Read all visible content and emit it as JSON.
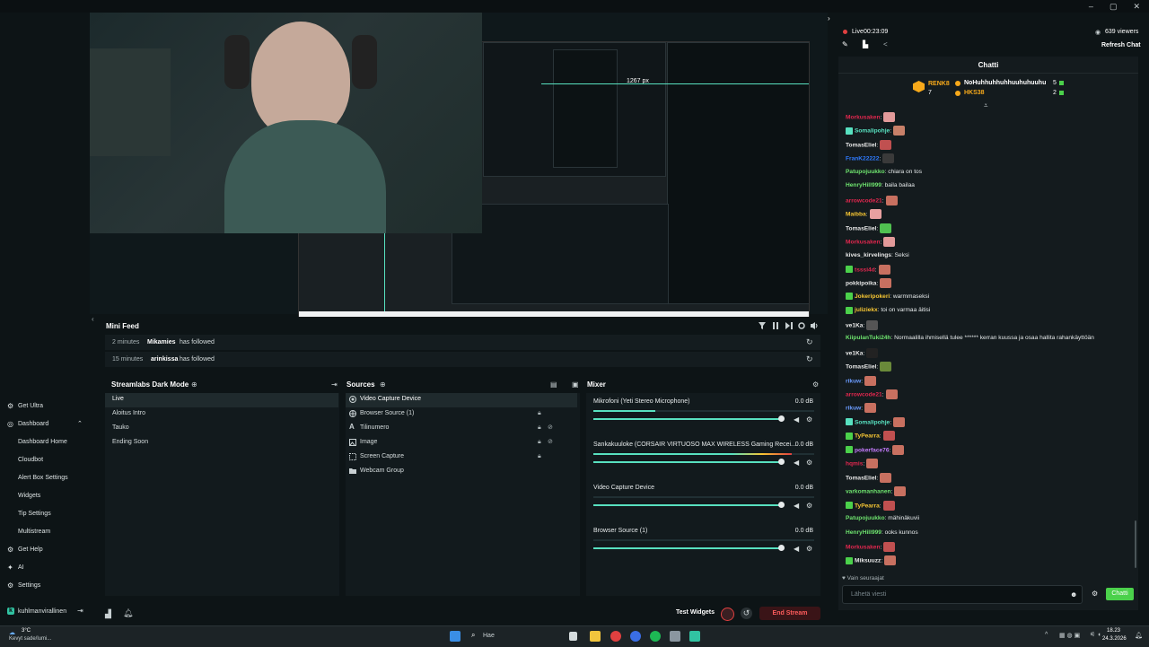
{
  "colors": {
    "accent": "#58e1c0",
    "brand": "#31c3a2",
    "live_red": "#e04040",
    "chat_bg": "#141b1e",
    "panel_bg": "#121a1d"
  },
  "preview": {
    "overlay_dim": "1267 px"
  },
  "minifeed": {
    "title": "Mini Feed",
    "events": [
      {
        "time": "2 minutes",
        "user": "Mikamies",
        "action": "has followed"
      },
      {
        "time": "15 minutes",
        "user": "arinkissa",
        "action": "has followed"
      }
    ]
  },
  "scenes": {
    "title": "Streamlabs Dark Mode",
    "items": [
      "Live",
      "Aloitus Intro",
      "Tauko",
      "Ending Soon"
    ],
    "selected": 0
  },
  "sources": {
    "title": "Sources",
    "items": [
      {
        "label": "Video Capture Device",
        "icon": "camera-icon"
      },
      {
        "label": "Browser Source (1)",
        "icon": "globe-icon"
      },
      {
        "label": "Tilinumero",
        "icon": "text-icon"
      },
      {
        "label": "Image",
        "icon": "image-icon"
      },
      {
        "label": "Screen Capture",
        "icon": "screen-capture-icon"
      },
      {
        "label": "Webcam Group",
        "icon": "folder-icon"
      }
    ]
  },
  "mixer": {
    "title": "Mixer",
    "channels": [
      {
        "name": "Mikrofoni (Yeti Stereo Microphone)",
        "db": "0.0 dB",
        "level": 0.28,
        "volume": 1.0
      },
      {
        "name": "Sankakuuloke (CORSAIR VIRTUOSO MAX WIRELESS Gaming Recei...",
        "db": "0.0 dB",
        "level": 0.9,
        "volume": 1.0
      },
      {
        "name": "Video Capture Device",
        "db": "0.0 dB",
        "level": 0,
        "volume": 1.0
      },
      {
        "name": "Browser Source (1)",
        "db": "0.0 dB",
        "level": 0,
        "volume": 1.0
      }
    ]
  },
  "nav": {
    "items": [
      {
        "label": "Get Ultra",
        "icon": "ultra-icon",
        "indent": false
      },
      {
        "label": "Dashboard",
        "icon": "dashboard-icon",
        "indent": false
      },
      {
        "label": "Dashboard Home",
        "icon": "",
        "indent": true
      },
      {
        "label": "Cloudbot",
        "icon": "",
        "indent": true
      },
      {
        "label": "Alert Box Settings",
        "icon": "",
        "indent": true
      },
      {
        "label": "Widgets",
        "icon": "",
        "indent": true
      },
      {
        "label": "Tip Settings",
        "icon": "",
        "indent": true
      },
      {
        "label": "Multistream",
        "icon": "",
        "indent": true
      },
      {
        "label": "Get Help",
        "icon": "help-icon",
        "indent": false
      },
      {
        "label": "AI",
        "icon": "ai-icon",
        "indent": false
      },
      {
        "label": "Settings",
        "icon": "gear-icon",
        "indent": false
      }
    ],
    "user": "kuhlmanvirallinen"
  },
  "footer": {
    "test_widgets": "Test Widgets",
    "end_stream": "End Stream"
  },
  "live": {
    "label": "Live",
    "time": "00:23:09",
    "viewers": "639 viewers",
    "refresh": "Refresh Chat"
  },
  "chat": {
    "title": "Chatti",
    "leaderboard": [
      {
        "rank_name": "RENK8",
        "rank_num": "7",
        "user": "NoHuhhuhhuhhuuhuhuuhu",
        "count": "5"
      },
      {
        "user": "HKS38",
        "count": "2"
      }
    ],
    "messages": [
      {
        "user": "Morkusaken",
        "color": "#e0274e",
        "text": ":",
        "emote": "#e29a9a"
      },
      {
        "user": "Somalipohje",
        "color": "#58e1c0",
        "text": ":",
        "emote": "#c88069",
        "badge": "#58e1c0"
      },
      {
        "user": "TomasEliel",
        "color": "#e8e8e8",
        "text": ":",
        "emote": "#c05050"
      },
      {
        "user": "FranK22222",
        "color": "#2f7bff",
        "text": ":",
        "emote": "#3a3a3a"
      },
      {
        "user": "Patupojuukko",
        "color": "#6ee36e",
        "text": ": chiara on tos"
      },
      {
        "user": "HenryHill999",
        "color": "#6ee36e",
        "text": ": baila bailaa"
      },
      {
        "user": "arrowcode21",
        "color": "#e0274e",
        "text": ":",
        "emote": "#c87060"
      },
      {
        "user": "Maibba",
        "color": "#f7c633",
        "text": ":",
        "emote": "#e8a0a0"
      },
      {
        "user": "TomasEliel",
        "color": "#e8e8e8",
        "text": ":",
        "emote": "#50c050"
      },
      {
        "user": "Morkusaken",
        "color": "#e0274e",
        "text": ":",
        "emote": "#e29a9a"
      },
      {
        "user": "kives_kirvelings",
        "color": "#e8e8e8",
        "text": ": Seksi"
      },
      {
        "user": "tsssi4d",
        "color": "#e0274e",
        "text": ":",
        "emote": "#c87060",
        "badge": "#4bd14b"
      },
      {
        "user": "pokkipoika",
        "color": "#e8e8e8",
        "text": ":",
        "emote": "#c87060"
      },
      {
        "user": "Jokeripokeri",
        "color": "#f7c633",
        "text": ": warmmaseksi",
        "badge": "#4bd14b"
      },
      {
        "user": "juliziekx",
        "color": "#f7c633",
        "text": ": toi on varmaa äitisi",
        "badge": "#4bd14b"
      },
      {
        "user": "ve1Ka",
        "color": "#e8e8e8",
        "text": ":",
        "emote": "#555555"
      },
      {
        "user": "KiipulanTuki24h",
        "color": "#6ee36e",
        "text": ": Normaalilla ihmisellä tulee ****** kerran kuussa ja osaa hallita rahankäyttöän"
      },
      {
        "user": "ve1Ka",
        "color": "#e8e8e8",
        "text": ":",
        "emote": "#222222"
      },
      {
        "user": "TomasEliel",
        "color": "#e8e8e8",
        "text": ":",
        "emote": "#6a8a3a"
      },
      {
        "user": "rikuw",
        "color": "#6b9cff",
        "text": ":",
        "emote": "#c87060"
      },
      {
        "user": "arrowcode21",
        "color": "#e0274e",
        "text": ":",
        "emote": "#c87060"
      },
      {
        "user": "rikuw",
        "color": "#6b9cff",
        "text": ":",
        "emote": "#c87060"
      },
      {
        "user": "Somalipohje",
        "color": "#58e1c0",
        "text": ":",
        "emote": "#c87060",
        "badge": "#58e1c0"
      },
      {
        "user": "TyPearra",
        "color": "#f7c633",
        "text": ":",
        "emote": "#c05050",
        "badge": "#4bd14b"
      },
      {
        "user": "pokerface76",
        "color": "#c77dff",
        "text": ":",
        "emote": "#c87060",
        "badge": "#4bd14b"
      },
      {
        "user": "hqmis",
        "color": "#e0274e",
        "text": ":",
        "emote": "#c87060"
      },
      {
        "user": "TomasEliel",
        "color": "#e8e8e8",
        "text": ":",
        "emote": "#c87060"
      },
      {
        "user": "varkomanhanen",
        "color": "#6ee36e",
        "text": ":",
        "emote": "#c87060"
      },
      {
        "user": "TyPearra",
        "color": "#f7c633",
        "text": ":",
        "emote": "#c05050",
        "badge": "#4bd14b"
      },
      {
        "user": "Patupojuukko",
        "color": "#6ee36e",
        "text": ": mähinäkuvii"
      },
      {
        "user": "HenryHill999",
        "color": "#6ee36e",
        "text": ": ooks kunnos"
      },
      {
        "user": "Morkusaken",
        "color": "#e0274e",
        "text": ":",
        "emote": "#c05050"
      },
      {
        "user": "Miksuuzz",
        "color": "#e8e8e8",
        "text": ":",
        "emote": "#c87060",
        "badge": "#4bd14b"
      }
    ],
    "followers_only": "Vain seuraajat",
    "input_placeholder": "Lähetä viesti",
    "send": "Chatti"
  },
  "taskbar": {
    "weather_temp": "3°C",
    "weather_desc": "Kevyt sade/lumi...",
    "search": "Hae",
    "time": "18.23",
    "date": "24.3.2026"
  }
}
